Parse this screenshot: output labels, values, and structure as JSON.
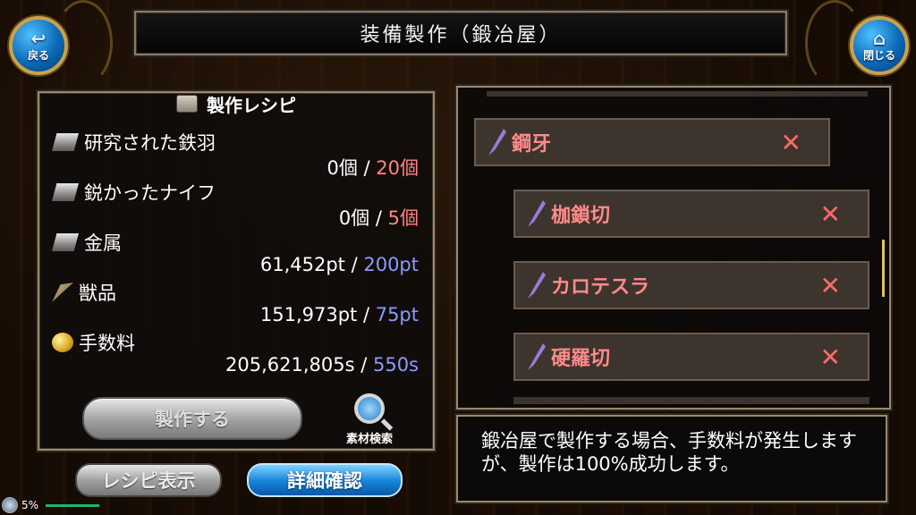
{
  "header": {
    "title": "装備製作（鍛冶屋）",
    "back_label": "戻る",
    "close_label": "閉じる"
  },
  "recipe": {
    "title": "製作レシピ",
    "materials": [
      {
        "name": "研究された鉄羽",
        "owned": "0個",
        "sep": " / ",
        "required": "20個",
        "icon": "ingot-icon",
        "req_color": "red"
      },
      {
        "name": "鋭かったナイフ",
        "owned": "0個",
        "sep": " / ",
        "required": "5個",
        "icon": "ingot-icon",
        "req_color": "red"
      },
      {
        "name": "金属",
        "owned": "61,452pt",
        "sep": " / ",
        "required": "200pt",
        "icon": "ingot-icon",
        "req_color": "blue"
      },
      {
        "name": "獣品",
        "owned": "151,973pt",
        "sep": " / ",
        "required": "75pt",
        "icon": "fang-icon",
        "req_color": "blue"
      },
      {
        "name": "手数料",
        "owned": "205,621,805s",
        "sep": " / ",
        "required": "550s",
        "icon": "coin-icon",
        "req_color": "blue"
      }
    ],
    "craft_label": "製作する",
    "search_label": "素材検索"
  },
  "bottom_buttons": {
    "recipe_label": "レシピ表示",
    "detail_label": "詳細確認"
  },
  "equipment_list": [
    {
      "name": "鋼牙",
      "remove": "✕"
    },
    {
      "name": "枷鎖切",
      "remove": "✕"
    },
    {
      "name": "カロテスラ",
      "remove": "✕"
    },
    {
      "name": "硬羅切",
      "remove": "✕"
    }
  ],
  "message": "鍛冶屋で製作する場合、手数料が発生しますが、製作は100%成功します。",
  "status": {
    "battery": "5%"
  },
  "colors": {
    "required_red": "#ff8585",
    "required_blue": "#8a9aff",
    "item_text": "#ff8a8a",
    "accent_gold": "#c9a24a"
  }
}
